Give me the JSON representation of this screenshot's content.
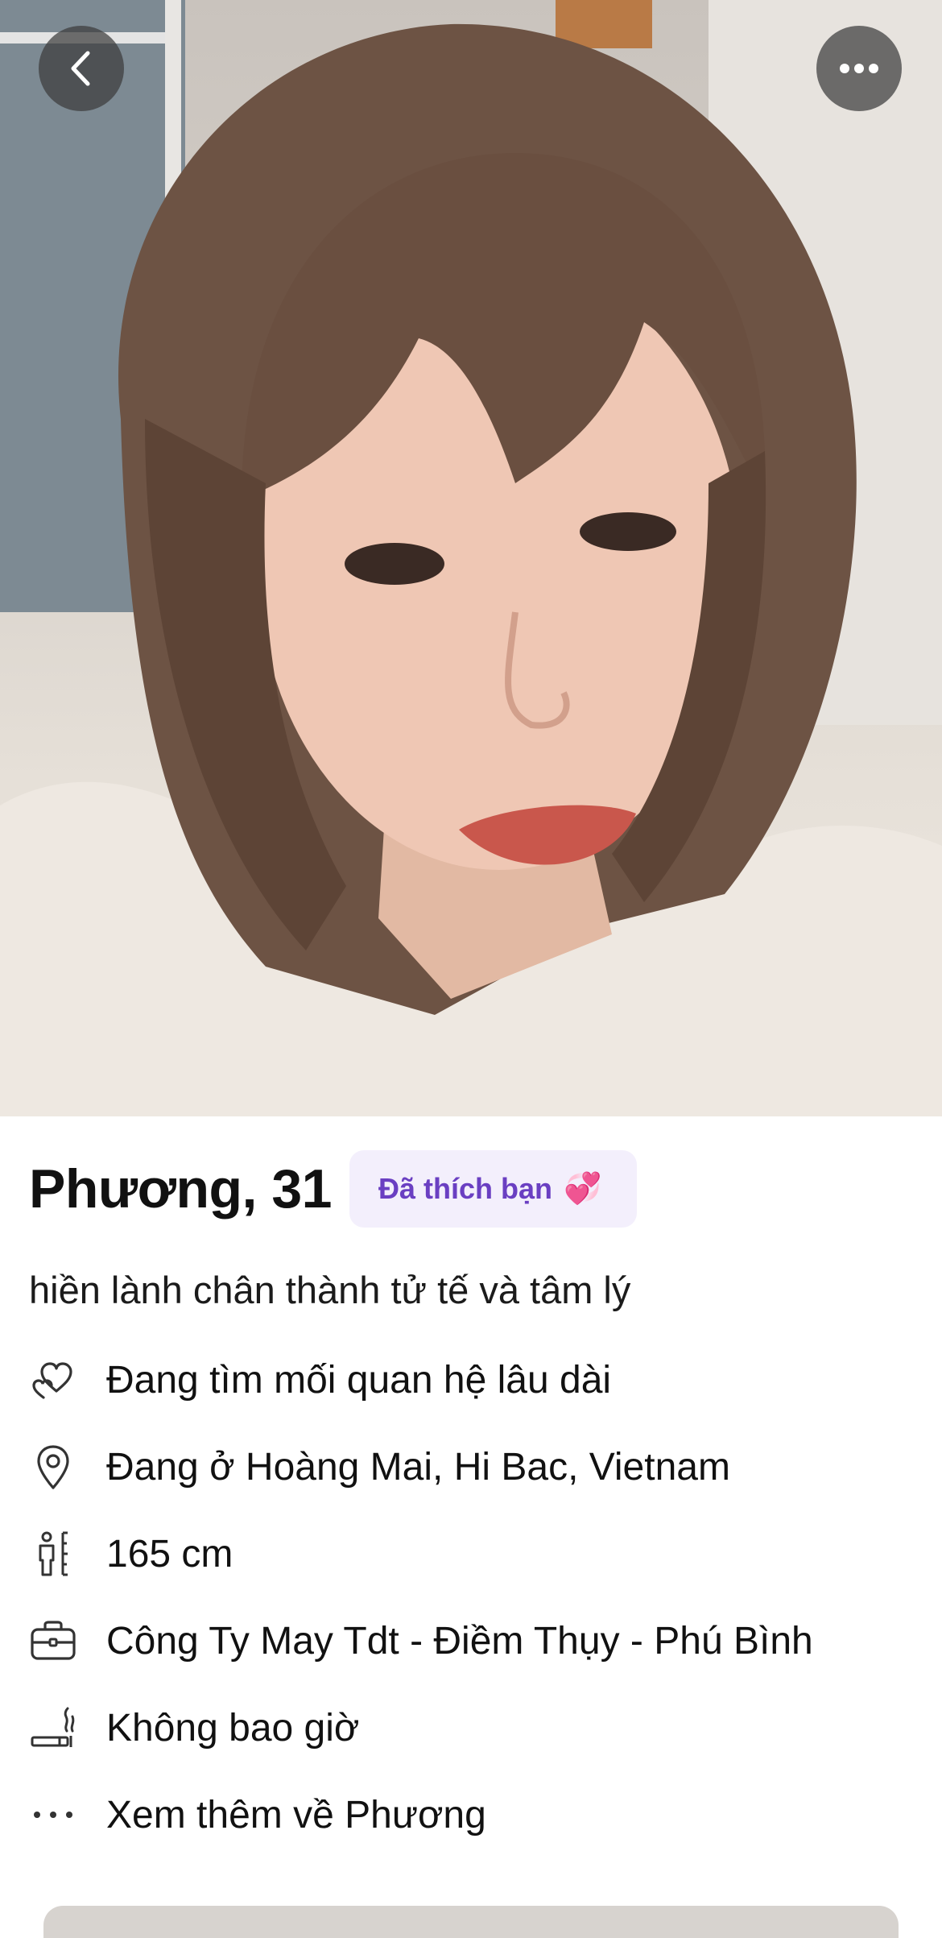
{
  "profile": {
    "photo_alt": "profile-photo",
    "name_age": "Phương, 31",
    "liked_badge": "Đã thích bạn",
    "liked_emoji": "💞",
    "bio": "hiền lành chân thành tử tế và tâm lý"
  },
  "details": [
    {
      "icon": "hearts-icon",
      "text": "Đang tìm mối quan hệ lâu dài"
    },
    {
      "icon": "location-pin-icon",
      "text": "Đang ở Hoàng Mai, Hi Bac, Vietnam"
    },
    {
      "icon": "height-icon",
      "text": "165 cm"
    },
    {
      "icon": "briefcase-icon",
      "text": "Công Ty May Tdt - Điềm Thụy - Phú Bình"
    },
    {
      "icon": "smoking-icon",
      "text": "Không bao giờ"
    },
    {
      "icon": "more-dots-icon",
      "text": "Xem thêm về Phương"
    }
  ],
  "colors": {
    "accent": "#6a3fc2",
    "badge_bg": "#f3effc",
    "text": "#111111",
    "overlay_button": "#3c3c3c"
  }
}
